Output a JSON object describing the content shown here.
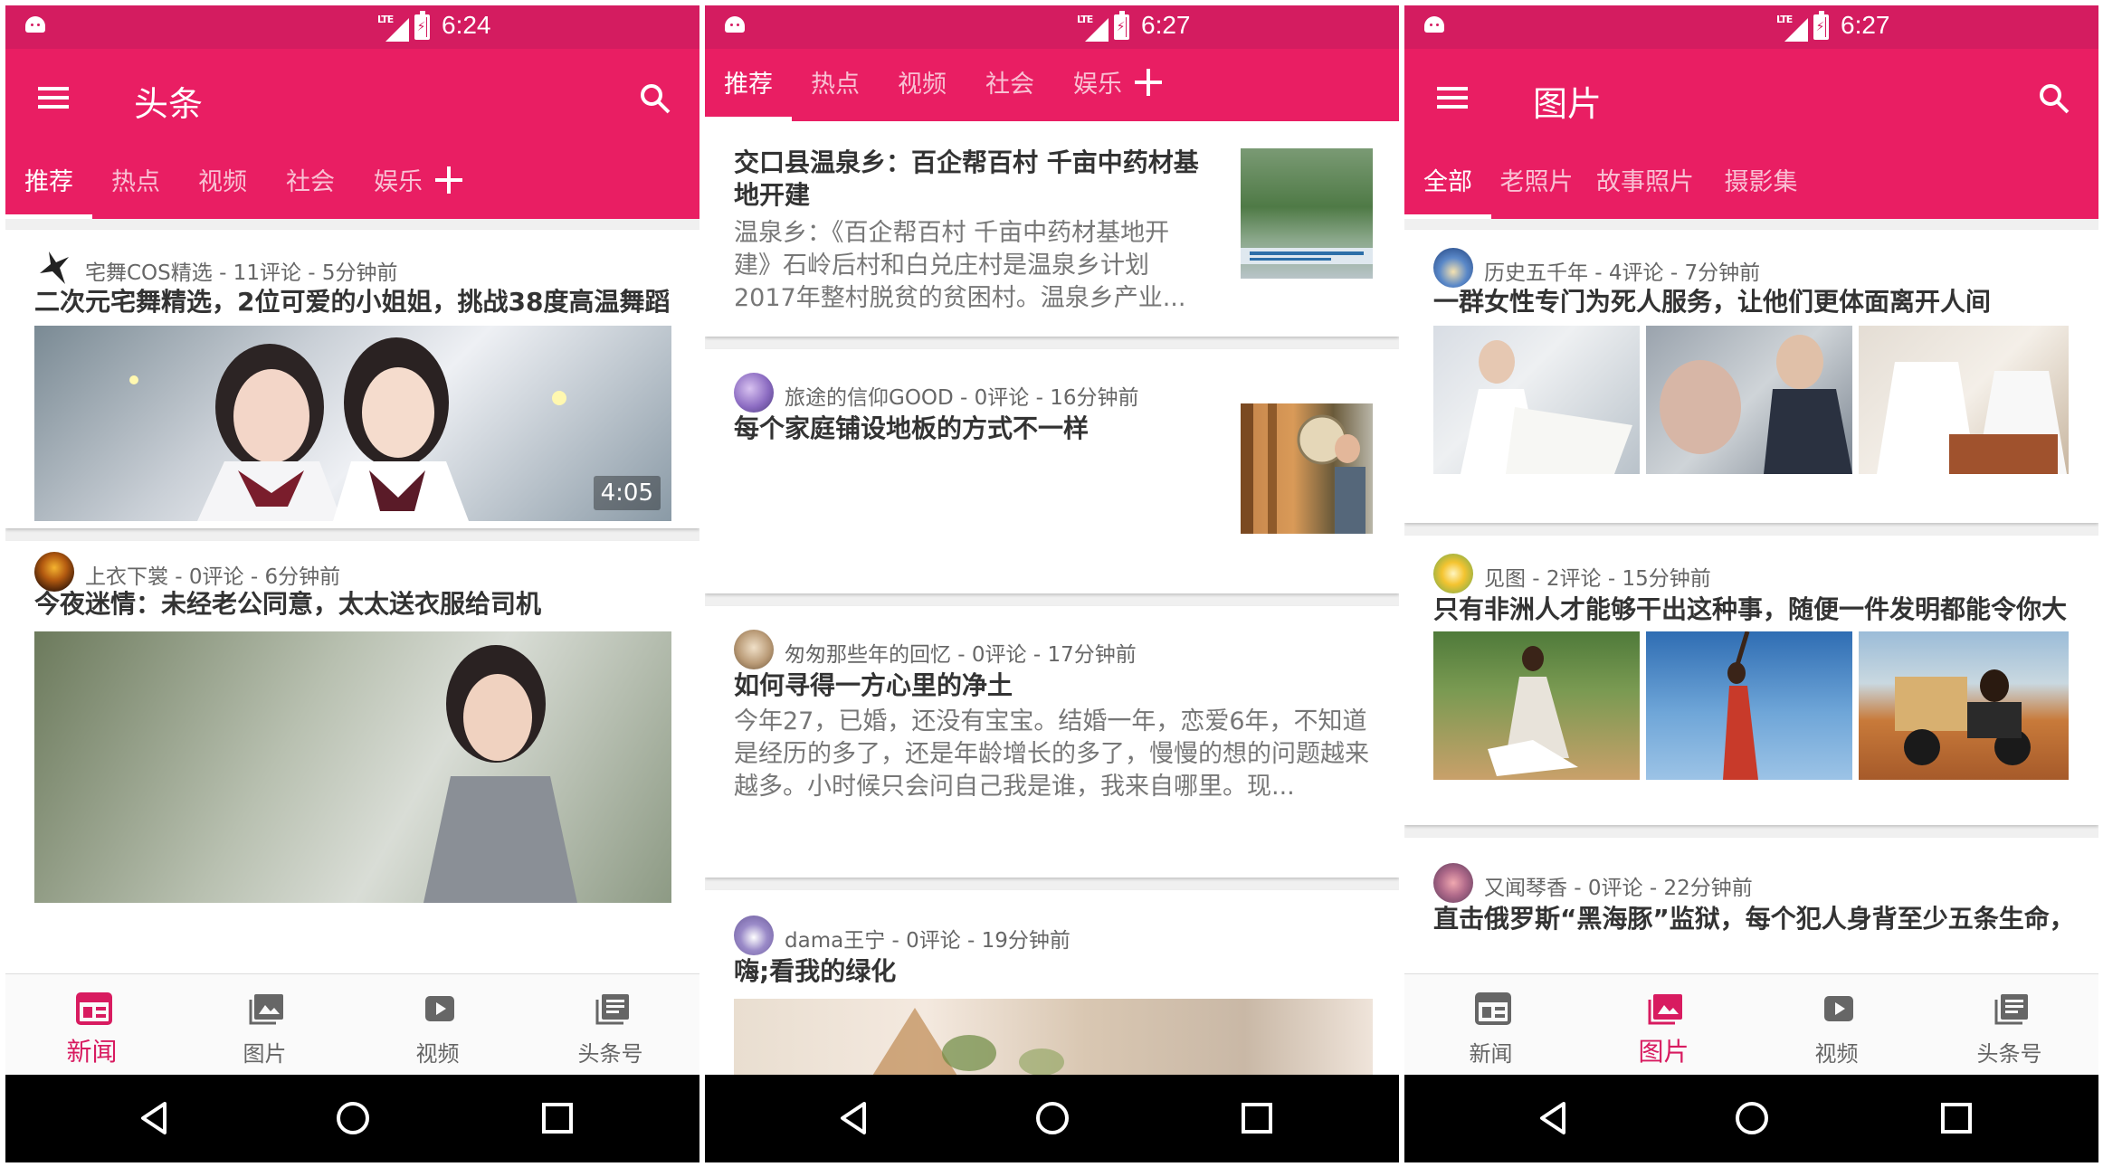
{
  "colors": {
    "primary": "#e91e63",
    "status_bar": "#d41c60",
    "active_nav": "#d81b60"
  },
  "screens": [
    {
      "status_time": "6:24",
      "network": "LTE",
      "title": "头条",
      "tabs": [
        {
          "label": "推荐"
        },
        {
          "label": "热点"
        },
        {
          "label": "视频"
        },
        {
          "label": "社会"
        },
        {
          "label": "娱乐"
        }
      ],
      "articles": [
        {
          "meta": "宅舞COS精选 - 11评论 - 5分钟前",
          "title": "二次元宅舞精选，2位可爱的小姐姐，挑战38度高温舞蹈",
          "duration": "4:05"
        },
        {
          "meta": "上衣下裳 - 0评论 - 6分钟前",
          "title": "今夜迷情：未经老公同意，太太送衣服给司机"
        }
      ],
      "nav": [
        {
          "label": "新闻"
        },
        {
          "label": "图片"
        },
        {
          "label": "视频"
        },
        {
          "label": "头条号"
        }
      ]
    },
    {
      "status_time": "6:27",
      "network": "LTE",
      "tabs": [
        {
          "label": "推荐"
        },
        {
          "label": "热点"
        },
        {
          "label": "视频"
        },
        {
          "label": "社会"
        },
        {
          "label": "娱乐"
        }
      ],
      "articles": [
        {
          "title": "交口县温泉乡：百企帮百村 千亩中药材基地开建",
          "summary": "温泉乡：《百企帮百村 千亩中药材基地开建》石岭后村和白兑庄村是温泉乡计划2017年整村脱贫的贫困村。温泉乡产业..."
        },
        {
          "meta": "旅途的信仰GOOD - 0评论 - 16分钟前",
          "title": "每个家庭铺设地板的方式不一样"
        },
        {
          "meta": "匆匆那些年的回忆 - 0评论 - 17分钟前",
          "title": "如何寻得一方心里的净土",
          "summary": "今年27，已婚，还没有宝宝。结婚一年，恋爱6年，不知道是经历的多了，还是年龄增长的多了，慢慢的想的问题越来越多。小时候只会问自己我是谁，我来自哪里。现..."
        },
        {
          "meta": "dama王宁 - 0评论 - 19分钟前",
          "title": "嗨;看我的绿化"
        }
      ]
    },
    {
      "status_time": "6:27",
      "network": "LTE",
      "title": "图片",
      "tabs": [
        {
          "label": "全部"
        },
        {
          "label": "老照片"
        },
        {
          "label": "故事照片"
        },
        {
          "label": "摄影集"
        }
      ],
      "articles": [
        {
          "meta": "历史五千年 - 4评论 - 7分钟前",
          "title": "一群女性专门为死人服务，让他们更体面离开人间"
        },
        {
          "meta": "见图 - 2评论 - 15分钟前",
          "title": "只有非洲人才能够干出这种事，随便一件发明都能令你大"
        },
        {
          "meta": "又闻琴香 - 0评论 - 22分钟前",
          "title": "直击俄罗斯“黑海豚”监狱，每个犯人身背至少五条生命，"
        }
      ],
      "nav": [
        {
          "label": "新闻"
        },
        {
          "label": "图片"
        },
        {
          "label": "视频"
        },
        {
          "label": "头条号"
        }
      ]
    }
  ]
}
